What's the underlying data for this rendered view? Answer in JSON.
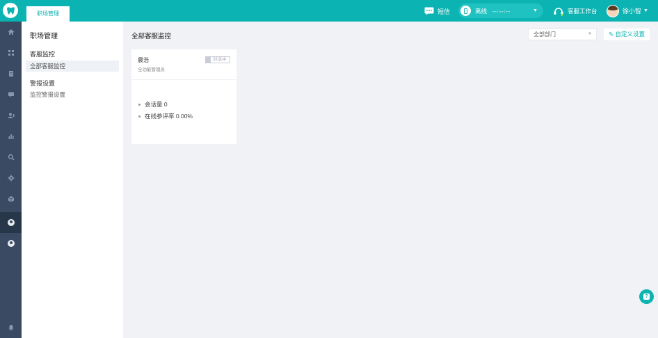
{
  "header": {
    "tab_label": "职场管理",
    "sms_label": "短信",
    "status_label": "离线",
    "status_time": "--:--:--",
    "workbench_label": "客服工作台",
    "user_name": "徐小智"
  },
  "rail": {
    "icons": [
      "home-icon",
      "grid-icon",
      "document-icon",
      "chat-icon",
      "contacts-icon",
      "chart-icon",
      "search-icon",
      "settings-icon",
      "package-icon",
      "monitor-icon",
      "user-icon",
      "bell-icon"
    ],
    "active_index": 9
  },
  "subnav": {
    "title": "职场管理",
    "group1": "客服监控",
    "item1": "全部客服监控",
    "group2": "警报设置",
    "item2": "监控警报设置"
  },
  "main": {
    "title": "全部客服监控",
    "department_select": "全部部门",
    "custom_settings": "自定义设置"
  },
  "card": {
    "name": "晨浩",
    "role": "全功能管理员",
    "badge": "对话中",
    "stat1": "会话量 0",
    "stat2": "在线参评率 0.00%"
  },
  "colors": {
    "accent": "#0bb3b2",
    "rail": "#3a4a63",
    "background": "#f0f2f5"
  }
}
